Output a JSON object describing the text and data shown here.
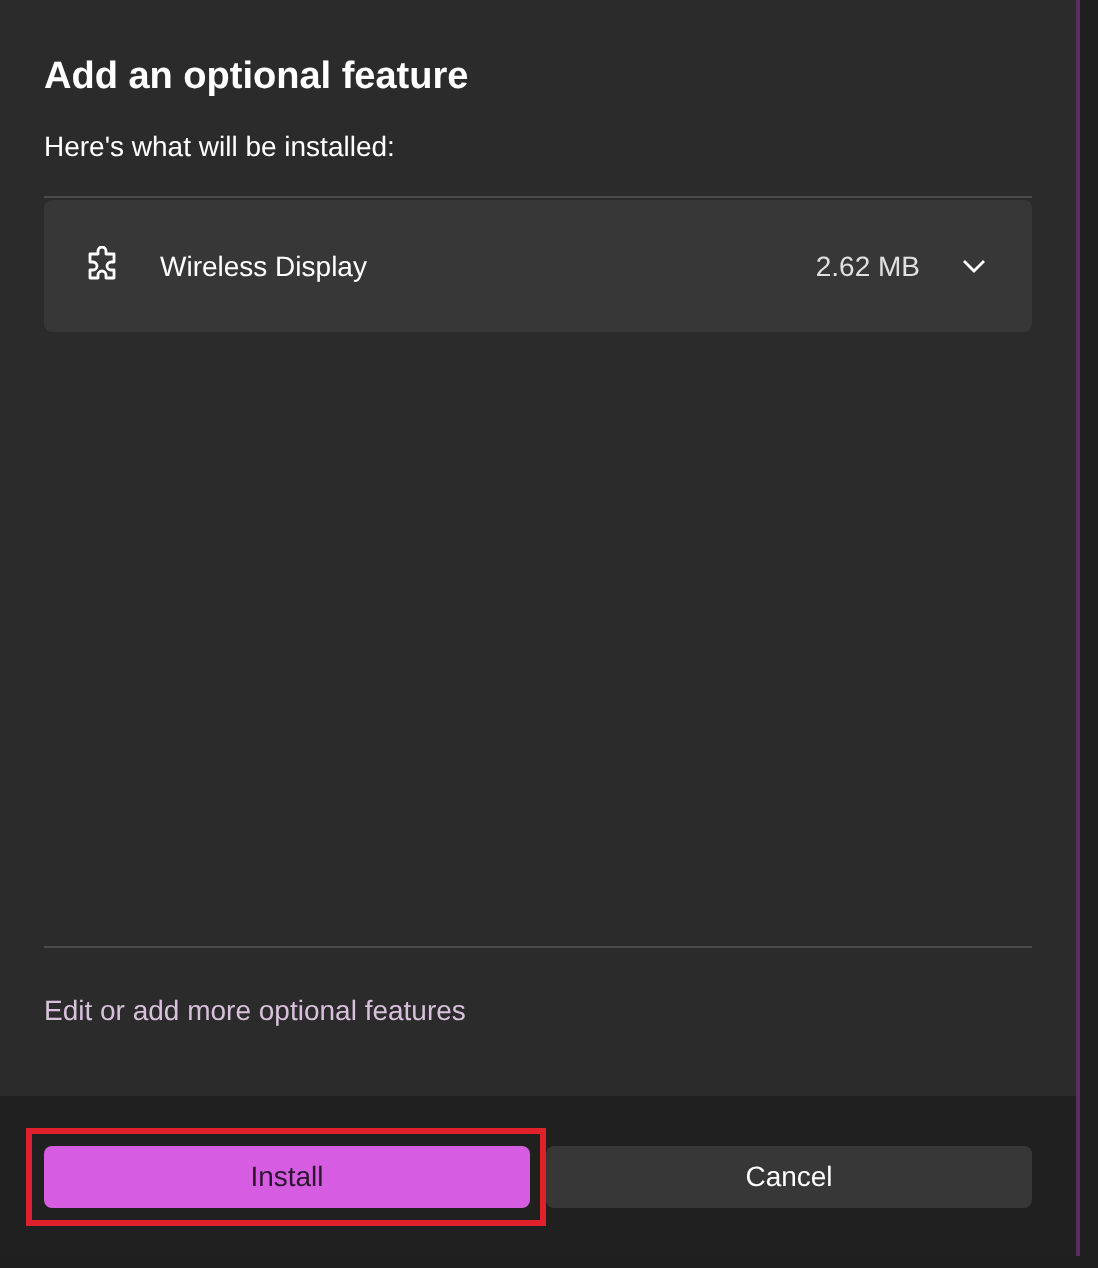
{
  "dialog": {
    "title": "Add an optional feature",
    "subtitle": "Here's what will be installed:"
  },
  "features": [
    {
      "name": "Wireless Display",
      "size": "2.62 MB",
      "expanded": false
    }
  ],
  "link": "Edit or add more optional features",
  "buttons": [
    {
      "label": "Install",
      "kind": "primary",
      "highlighted": true
    },
    {
      "label": "Cancel",
      "kind": "secondary",
      "highlighted": false
    }
  ]
}
